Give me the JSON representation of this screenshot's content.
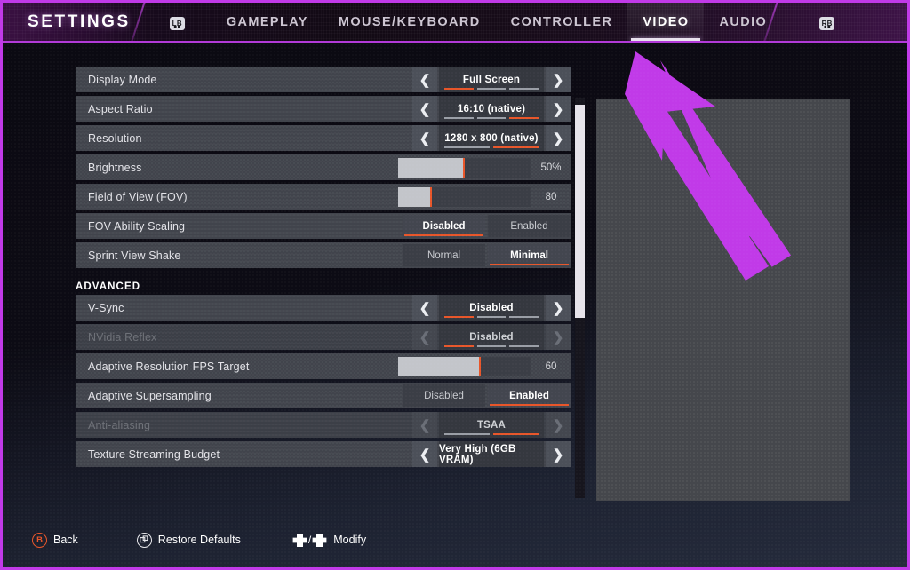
{
  "header": {
    "title": "SETTINGS",
    "left_bumper": "LB",
    "right_bumper": "RB",
    "tabs": [
      {
        "label": "GAMEPLAY",
        "active": false
      },
      {
        "label": "MOUSE/KEYBOARD",
        "active": false
      },
      {
        "label": "CONTROLLER",
        "active": false
      },
      {
        "label": "VIDEO",
        "active": true
      },
      {
        "label": "AUDIO",
        "active": false
      }
    ]
  },
  "settings": {
    "rows": [
      {
        "kind": "spinner",
        "label": "Display Mode",
        "value": "Full Screen",
        "segments": 3,
        "selected_segment": 1,
        "disabled": false
      },
      {
        "kind": "spinner",
        "label": "Aspect Ratio",
        "value": "16:10 (native)",
        "segments": 3,
        "selected_segment": 3,
        "disabled": false
      },
      {
        "kind": "spinner",
        "label": "Resolution",
        "value": "1280 x 800 (native)",
        "segments": 2,
        "selected_segment": 2,
        "disabled": false
      },
      {
        "kind": "slider",
        "label": "Brightness",
        "value": "50%",
        "fill_percent": 50,
        "disabled": false
      },
      {
        "kind": "slider",
        "label": "Field of View (FOV)",
        "value": "80",
        "fill_percent": 25,
        "disabled": false
      },
      {
        "kind": "toggle",
        "label": "FOV Ability Scaling",
        "options": [
          "Disabled",
          "Enabled"
        ],
        "selected": "Disabled",
        "disabled": false
      },
      {
        "kind": "toggle",
        "label": "Sprint View Shake",
        "options": [
          "Normal",
          "Minimal"
        ],
        "selected": "Minimal",
        "disabled": false
      },
      {
        "kind": "section",
        "label": "ADVANCED"
      },
      {
        "kind": "spinner",
        "label": "V-Sync",
        "value": "Disabled",
        "segments": 3,
        "selected_segment": 1,
        "disabled": false
      },
      {
        "kind": "spinner",
        "label": "NVidia Reflex",
        "value": "Disabled",
        "segments": 3,
        "selected_segment": 1,
        "disabled": true
      },
      {
        "kind": "slider",
        "label": "Adaptive Resolution FPS Target",
        "value": "60",
        "fill_percent": 62,
        "disabled": false
      },
      {
        "kind": "toggle",
        "label": "Adaptive Supersampling",
        "options": [
          "Disabled",
          "Enabled"
        ],
        "selected": "Enabled",
        "disabled": false
      },
      {
        "kind": "spinner",
        "label": "Anti-aliasing",
        "value": "TSAA",
        "segments": 2,
        "selected_segment": 2,
        "disabled": true
      },
      {
        "kind": "spinner",
        "label": "Texture Streaming Budget",
        "value": "Very High (6GB VRAM)",
        "segments": 0,
        "selected_segment": 0,
        "disabled": false
      }
    ]
  },
  "footer": {
    "back_button": "B",
    "back_label": "Back",
    "restore_label": "Restore Defaults",
    "modify_separator": "/",
    "modify_label": "Modify"
  },
  "colors": {
    "accent_orange": "#e8562a",
    "annotation_magenta": "#c13ae8",
    "row_background": "#41444c",
    "panel_background": "#45474c"
  }
}
